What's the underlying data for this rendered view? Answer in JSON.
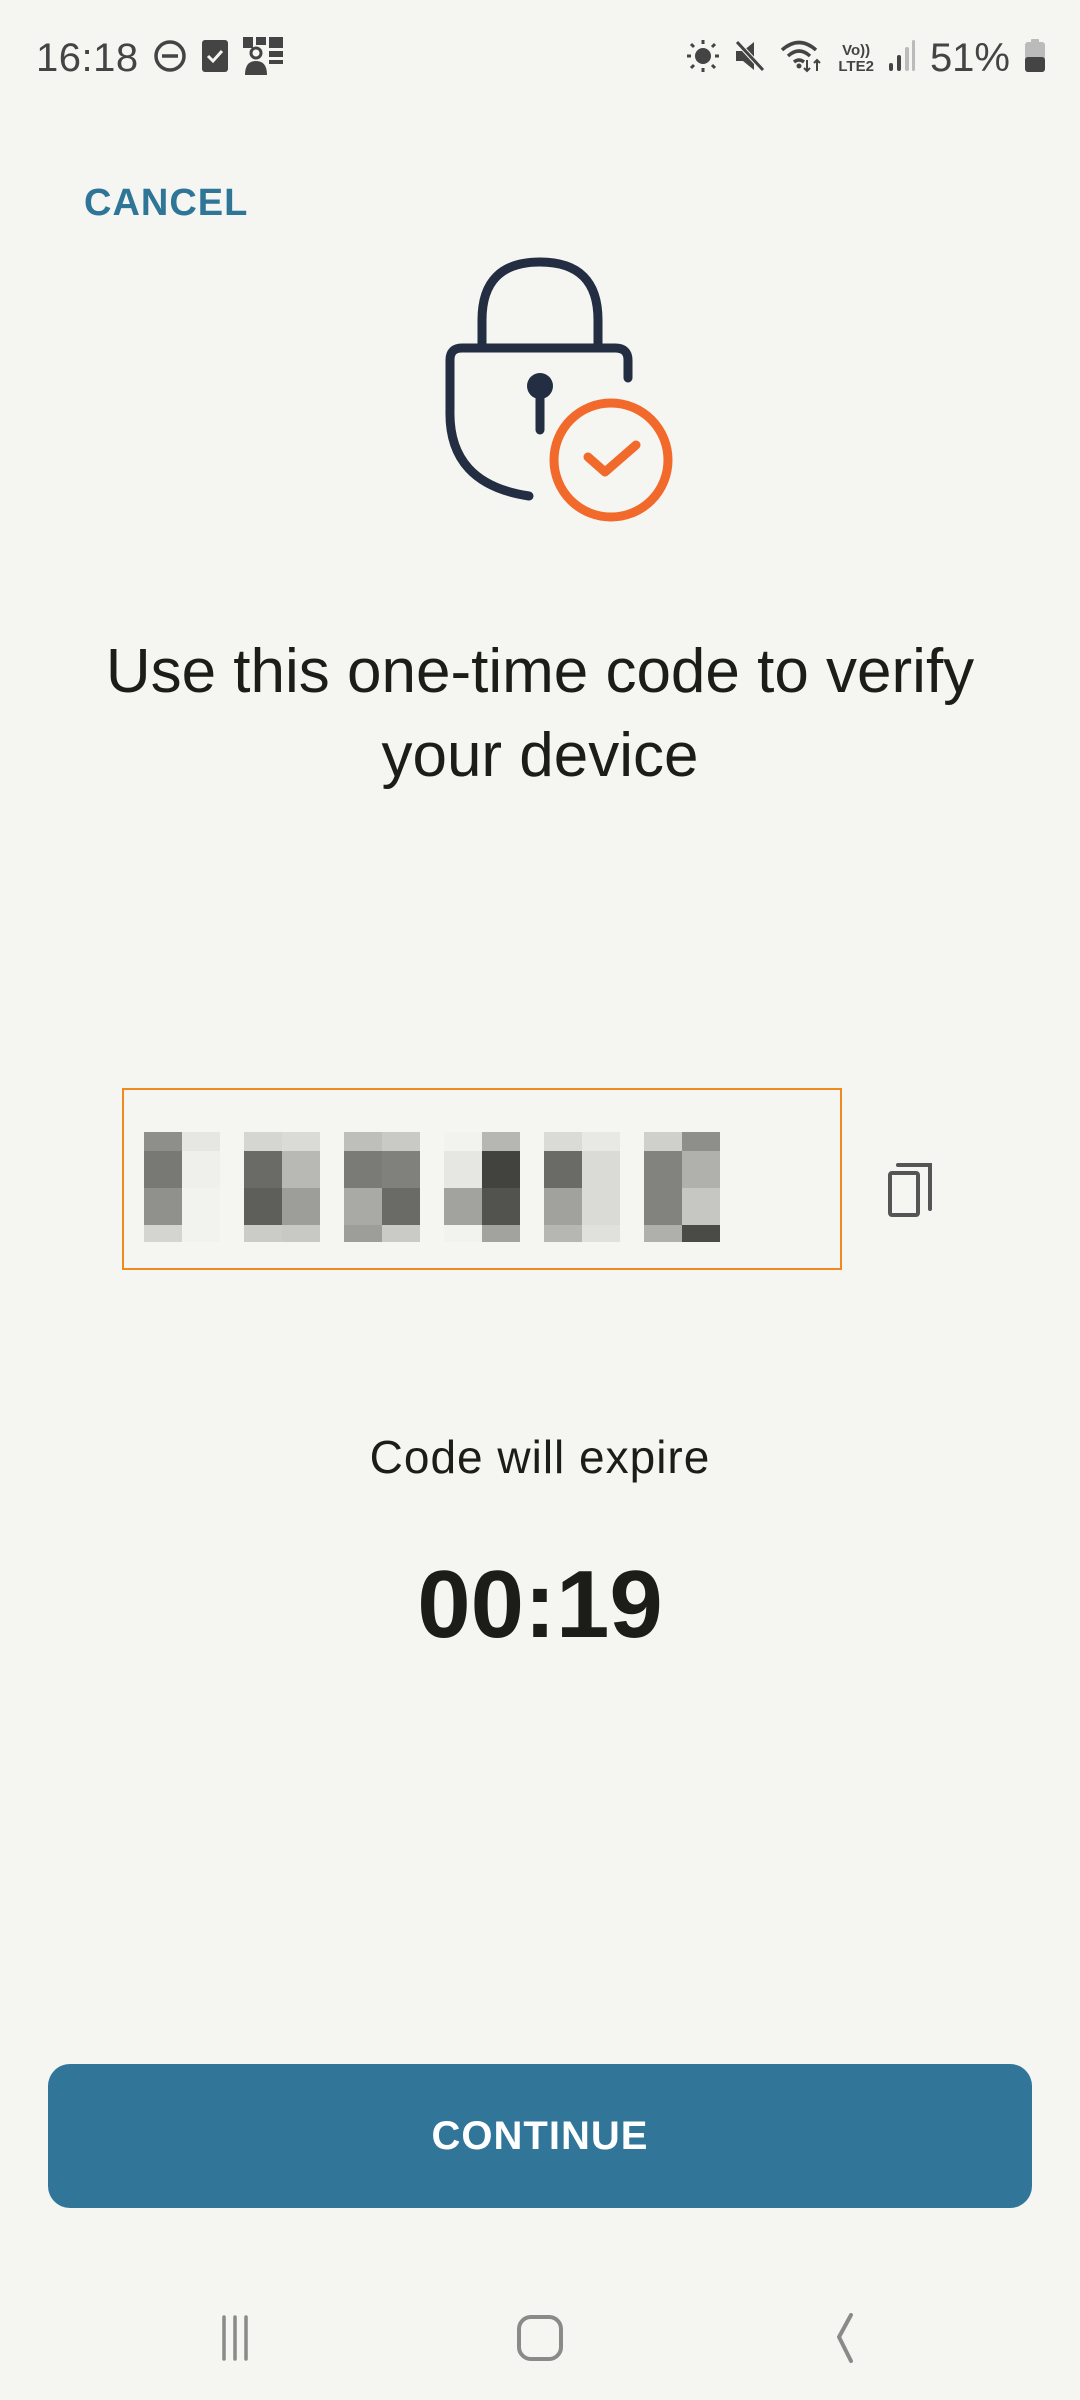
{
  "status_bar": {
    "time": "16:18",
    "left_icons": [
      "do-not-disturb-icon",
      "task-check-icon",
      "contact-card-icon"
    ],
    "right_icons": [
      "brightness-icon",
      "mute-icon",
      "wifi-icon",
      "volte-icon",
      "signal-icon",
      "battery-icon"
    ],
    "volte_top": "Vo))",
    "volte_bottom": "LTE2",
    "battery_percent": "51%",
    "battery_level": 0.51
  },
  "header": {
    "cancel_label": "CANCEL"
  },
  "hero": {
    "icon": "lock-check-icon",
    "lock_color": "#242e42",
    "check_color": "#f26a2b"
  },
  "main": {
    "headline": "Use this one-time code to verify your device",
    "code": {
      "value_obscured": true,
      "digit_count": 6,
      "border_color": "#f08a1c",
      "copy_icon": "copy-icon"
    },
    "expire_label": "Code will expire",
    "timer": "00:19"
  },
  "footer": {
    "continue_label": "CONTINUE",
    "button_color": "#317698"
  },
  "nav_bar": {
    "recents": "recent-apps-icon",
    "home": "home-icon",
    "back": "back-icon"
  }
}
